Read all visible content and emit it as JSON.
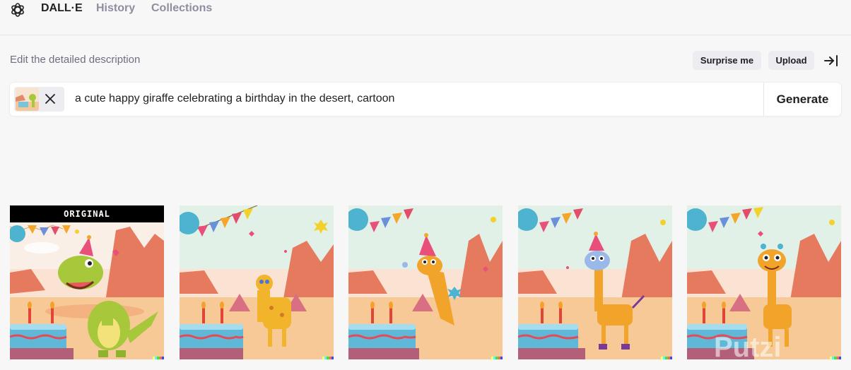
{
  "nav": {
    "brand": "DALL·E",
    "history": "History",
    "collections": "Collections"
  },
  "editor": {
    "label": "Edit the detailed description",
    "surprise_label": "Surprise me",
    "upload_label": "Upload",
    "prompt": "a cute happy giraffe celebrating a birthday in the desert, cartoon",
    "generate_label": "Generate"
  },
  "gallery": {
    "original_badge": "ORIGINAL",
    "cards": [
      {
        "subject": "dinosaur",
        "original": true
      },
      {
        "subject": "giraffe"
      },
      {
        "subject": "giraffe"
      },
      {
        "subject": "giraffe"
      },
      {
        "subject": "giraffe"
      }
    ]
  },
  "watermark": "Putzi",
  "colors": {
    "background": "#f7f7f8",
    "accent_text": "#202123",
    "muted_text": "#8e8ea0",
    "pill_bg": "#ececf1"
  },
  "icons": {
    "logo": "openai-logo-icon",
    "collapse": "collapse-right-icon",
    "remove": "close-icon"
  }
}
